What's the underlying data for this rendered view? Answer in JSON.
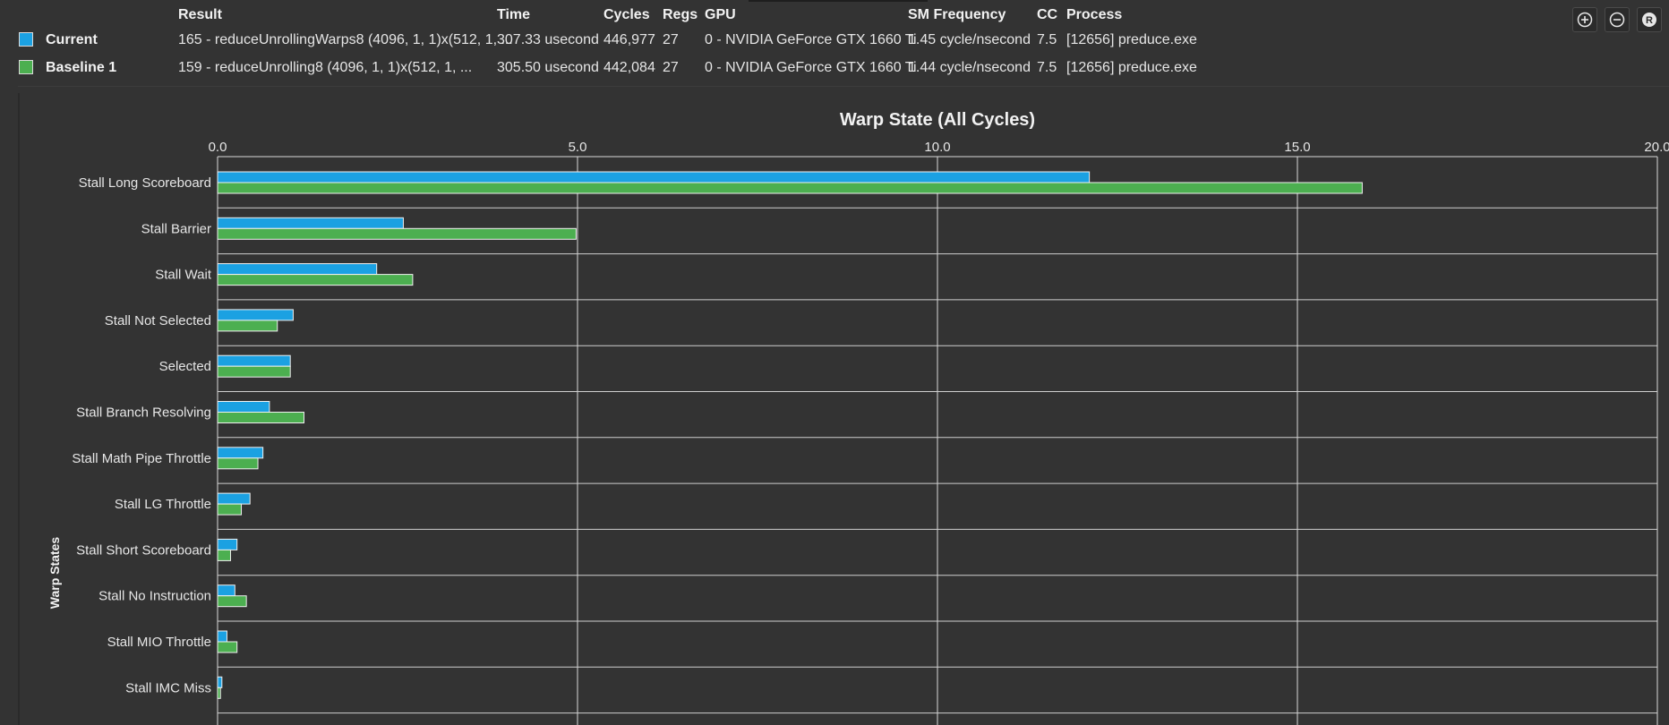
{
  "header": {
    "columns": {
      "result": "Result",
      "time": "Time",
      "cycles": "Cycles",
      "regs": "Regs",
      "gpu": "GPU",
      "sm_frequency": "SM Frequency",
      "cc": "CC",
      "process": "Process"
    },
    "rows": [
      {
        "name": "Current",
        "color": "#1ba1e2",
        "result": "165 - reduceUnrollingWarps8 (4096, 1, 1)x(512, 1, ...",
        "time": "307.33 usecond",
        "cycles": "446,977",
        "regs": "27",
        "gpu": "0 - NVIDIA GeForce GTX 1660 Ti",
        "sm_frequency": "1.45 cycle/nsecond",
        "cc": "7.5",
        "process": "[12656] preduce.exe"
      },
      {
        "name": "Baseline 1",
        "color": "#4caf50",
        "result": "159 - reduceUnrolling8 (4096, 1, 1)x(512, 1, ...",
        "time": "305.50 usecond",
        "cycles": "442,084",
        "regs": "27",
        "gpu": "0 - NVIDIA GeForce GTX 1660 Ti",
        "sm_frequency": "1.44 cycle/nsecond",
        "cc": "7.5",
        "process": "[12656] preduce.exe"
      }
    ]
  },
  "toolbar": {
    "zoom_in_icon": "zoom-in-icon",
    "zoom_out_icon": "zoom-out-icon",
    "reset_icon": "reset-icon",
    "reset_letter": "R"
  },
  "chart_data": {
    "type": "bar",
    "orientation": "horizontal",
    "title": "Warp State (All Cycles)",
    "ylabel": "Warp States",
    "xlabel": "",
    "xlim": [
      0,
      20
    ],
    "xticks": [
      "0.0",
      "5.0",
      "10.0",
      "15.0",
      "20.0"
    ],
    "xtick_values": [
      0,
      5,
      10,
      15,
      20
    ],
    "grid": true,
    "categories": [
      "Stall Long Scoreboard",
      "Stall Barrier",
      "Stall Wait",
      "Stall Not Selected",
      "Selected",
      "Stall Branch Resolving",
      "Stall Math Pipe Throttle",
      "Stall LG Throttle",
      "Stall Short Scoreboard",
      "Stall No Instruction",
      "Stall MIO Throttle",
      "Stall IMC Miss"
    ],
    "series": [
      {
        "name": "Current",
        "color": "#1ba1e2",
        "values": [
          12.11,
          2.58,
          2.21,
          1.05,
          1.01,
          0.72,
          0.63,
          0.45,
          0.27,
          0.24,
          0.13,
          0.06
        ]
      },
      {
        "name": "Baseline 1",
        "color": "#4caf50",
        "values": [
          15.9,
          4.98,
          2.71,
          0.83,
          1.01,
          1.2,
          0.56,
          0.33,
          0.18,
          0.4,
          0.27,
          0.04
        ]
      }
    ]
  }
}
